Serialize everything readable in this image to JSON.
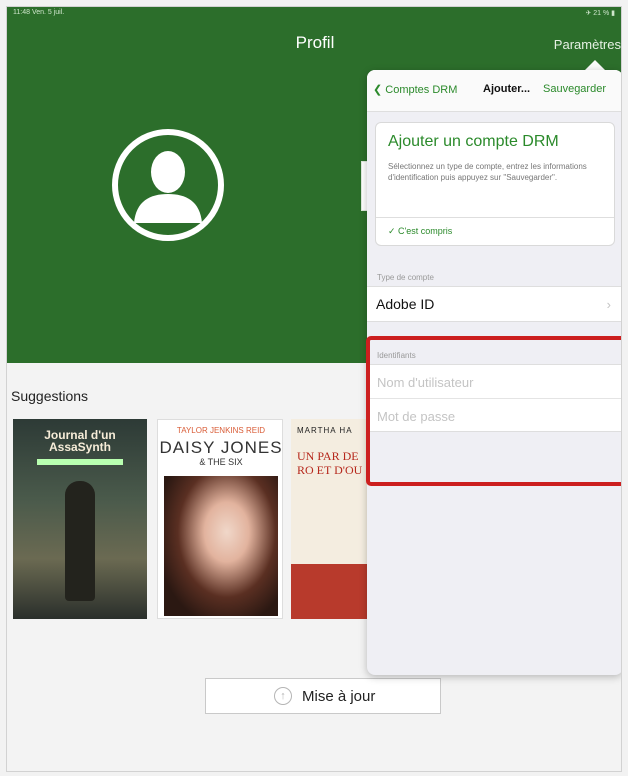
{
  "status_bar": {
    "time_date": "11:48  Ven. 5 juil.",
    "right": "✈ 21 % ▮"
  },
  "nav": {
    "title": "Profil",
    "right_button": "Paramètres"
  },
  "suggestions": {
    "title": "Suggestions",
    "books": [
      {
        "title": "Journal d'un AssaSynth",
        "subtitle": "",
        "author": ""
      },
      {
        "author": "TAYLOR JENKINS REID",
        "title": "DAISY JONES",
        "subtitle": "& THE SIX"
      },
      {
        "author": "MARTHA HA",
        "title": "UN PAR DE RO ET D'OU"
      }
    ]
  },
  "update_button": {
    "icon": "arrow-up-circle-icon",
    "label": "Mise à jour"
  },
  "popover": {
    "back_label": "Comptes DRM",
    "title": "Ajouter...",
    "save_label": "Sauvegarder",
    "intro": {
      "title": "Ajouter un compte DRM",
      "text": "Sélectionnez un type de compte, entrez les informations d'identification puis appuyez sur \"Sauvegarder\".",
      "ok_label": "✓  C'est compris"
    },
    "account_type": {
      "section": "Type de compte",
      "value": "Adobe ID",
      "chevron": "›"
    },
    "credentials": {
      "section": "Identifiants",
      "username_placeholder": "Nom d'utilisateur",
      "password_placeholder": "Mot de passe"
    }
  },
  "colors": {
    "header_green": "#2c6e2b",
    "accent_green": "#2b8a2b",
    "highlight_red": "#cc1f1f"
  }
}
